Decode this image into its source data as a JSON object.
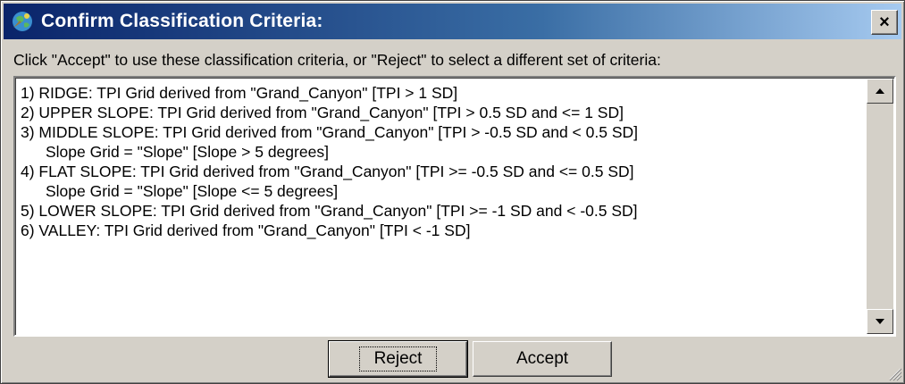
{
  "window": {
    "title": "Confirm Classification Criteria:",
    "close_label": "×",
    "app_icon": "globe-icon"
  },
  "instruction": "Click \"Accept\" to use these classification criteria, or \"Reject\" to select a different set of criteria:",
  "criteria_lines": [
    "1) RIDGE: TPI Grid derived from \"Grand_Canyon\"  [TPI  > 1 SD]",
    "2) UPPER SLOPE: TPI Grid derived from \"Grand_Canyon\"  [TPI  > 0.5 SD and  <= 1 SD]",
    "3) MIDDLE SLOPE: TPI Grid derived from \"Grand_Canyon\"  [TPI  > -0.5 SD and  < 0.5 SD]",
    "Slope Grid = \"Slope\" [Slope  > 5 degrees]",
    "4) FLAT SLOPE: TPI Grid derived from \"Grand_Canyon\"  [TPI  >= -0.5 SD and  <= 0.5 SD]",
    "Slope Grid = \"Slope\" [Slope  <= 5 degrees]",
    "5) LOWER SLOPE: TPI Grid derived from \"Grand_Canyon\"  [TPI  >= -1 SD and  < -0.5 SD]",
    "6) VALLEY: TPI Grid derived from \"Grand_Canyon\"  [TPI  < -1 SD]"
  ],
  "buttons": {
    "reject": "Reject",
    "accept": "Accept"
  }
}
